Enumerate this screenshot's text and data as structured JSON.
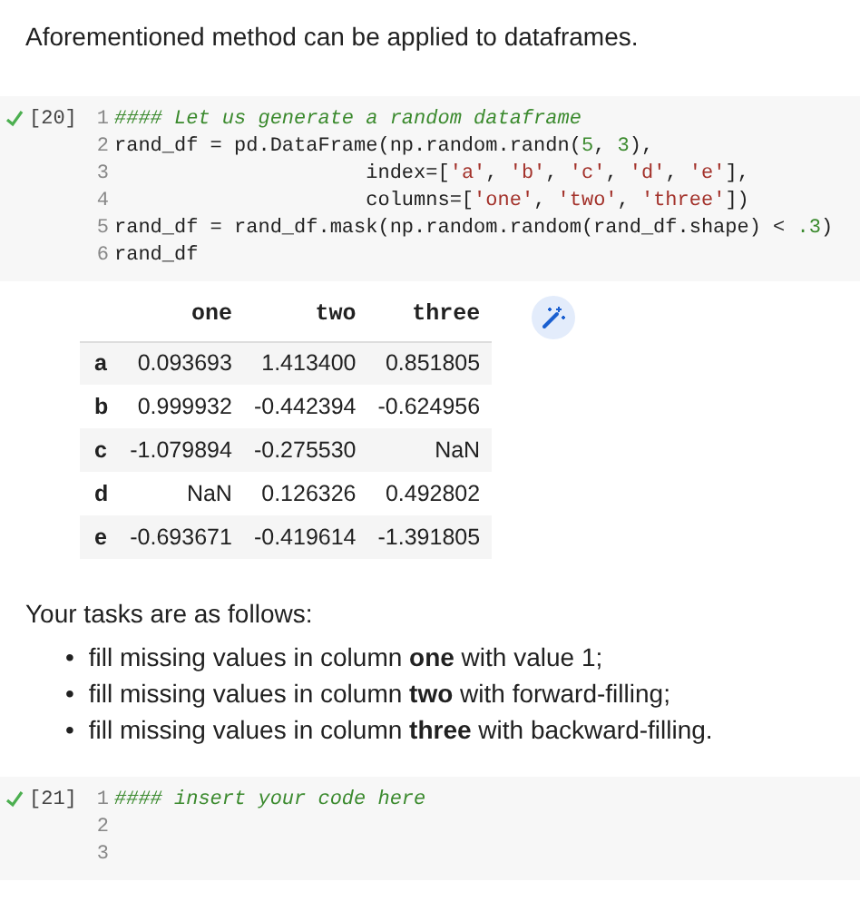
{
  "intro": "Aforementioned method can be applied to dataframes.",
  "cells": [
    {
      "count": "[20]",
      "ran": true,
      "lines": [
        {
          "number": "1",
          "tokens": [
            {
              "kind": "comment",
              "text": "#### Let us generate a random dataframe"
            }
          ]
        },
        {
          "number": "2",
          "tokens": [
            {
              "kind": "plain",
              "text": "rand_df = pd.DataFrame(np.random.randn("
            },
            {
              "kind": "number",
              "text": "5"
            },
            {
              "kind": "plain",
              "text": ", "
            },
            {
              "kind": "number",
              "text": "3"
            },
            {
              "kind": "plain",
              "text": "),"
            }
          ]
        },
        {
          "number": "3",
          "tokens": [
            {
              "kind": "plain",
              "text": "                     index=["
            },
            {
              "kind": "string",
              "text": "'a'"
            },
            {
              "kind": "plain",
              "text": ", "
            },
            {
              "kind": "string",
              "text": "'b'"
            },
            {
              "kind": "plain",
              "text": ", "
            },
            {
              "kind": "string",
              "text": "'c'"
            },
            {
              "kind": "plain",
              "text": ", "
            },
            {
              "kind": "string",
              "text": "'d'"
            },
            {
              "kind": "plain",
              "text": ", "
            },
            {
              "kind": "string",
              "text": "'e'"
            },
            {
              "kind": "plain",
              "text": "],"
            }
          ]
        },
        {
          "number": "4",
          "tokens": [
            {
              "kind": "plain",
              "text": "                     columns=["
            },
            {
              "kind": "string",
              "text": "'one'"
            },
            {
              "kind": "plain",
              "text": ", "
            },
            {
              "kind": "string",
              "text": "'two'"
            },
            {
              "kind": "plain",
              "text": ", "
            },
            {
              "kind": "string",
              "text": "'three'"
            },
            {
              "kind": "plain",
              "text": "])"
            }
          ]
        },
        {
          "number": "5",
          "tokens": [
            {
              "kind": "plain",
              "text": "rand_df = rand_df.mask(np.random.random(rand_df.shape) < "
            },
            {
              "kind": "number",
              "text": ".3"
            },
            {
              "kind": "plain",
              "text": ")"
            }
          ]
        },
        {
          "number": "6",
          "tokens": [
            {
              "kind": "plain",
              "text": "rand_df"
            }
          ]
        }
      ],
      "output": {
        "columns": [
          "one",
          "two",
          "three"
        ],
        "rows": [
          {
            "index": "a",
            "values": [
              "0.093693",
              "1.413400",
              "0.851805"
            ]
          },
          {
            "index": "b",
            "values": [
              "0.999932",
              "-0.442394",
              "-0.624956"
            ]
          },
          {
            "index": "c",
            "values": [
              "-1.079894",
              "-0.275530",
              "NaN"
            ]
          },
          {
            "index": "d",
            "values": [
              "NaN",
              "0.126326",
              "0.492802"
            ]
          },
          {
            "index": "e",
            "values": [
              "-0.693671",
              "-0.419614",
              "-1.391805"
            ]
          }
        ]
      }
    },
    {
      "kind": "text",
      "lead": "Your tasks are as follows:",
      "bullets": [
        {
          "marker": "•",
          "text": "fill missing values in column **one** with value 1;"
        },
        {
          "marker": "•",
          "text": "fill missing values in column **two** with forward-filling;"
        },
        {
          "marker": "•",
          "text": "fill missing values in column **three** with backward-filling."
        }
      ]
    },
    {
      "count": "[21]",
      "ran": true,
      "lines": [
        {
          "number": "1",
          "tokens": [
            {
              "kind": "comment",
              "text": "#### insert your code here"
            }
          ]
        },
        {
          "number": "2"
        },
        {
          "number": "3"
        }
      ]
    }
  ]
}
